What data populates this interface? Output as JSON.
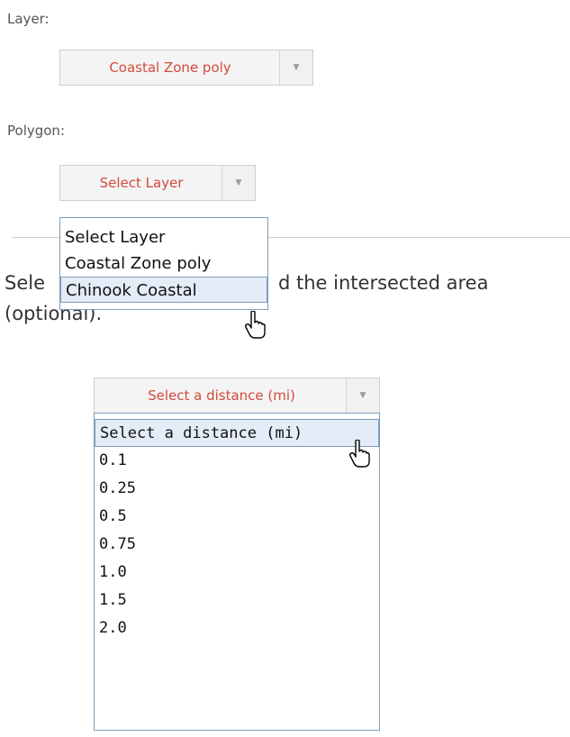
{
  "layer_field": {
    "label": "Layer:",
    "selected": "Coastal Zone poly"
  },
  "polygon_field": {
    "label": "Polygon:",
    "selected": "Select Layer",
    "options": [
      "Select Layer",
      "Coastal Zone poly",
      "Chinook Coastal"
    ],
    "hovered_option": "Chinook Coastal"
  },
  "distance_prompt": {
    "text_visible_left": "Sele",
    "text_visible_right": "d the intersected area",
    "text_line2": "(optional)."
  },
  "distance_field": {
    "selected": "Select a distance (mi)",
    "options": [
      "Select a distance (mi)",
      "0.1",
      "0.25",
      "0.5",
      "0.75",
      "1.0",
      "1.5",
      "2.0"
    ],
    "hovered_option": "Select a distance (mi)"
  },
  "icons": {
    "dropdown_arrow": "chevron-down-icon",
    "cursor": "hand-pointer-icon"
  },
  "colors": {
    "select_text": "#d24a3c",
    "dropdown_border": "#7f9db9",
    "hover_bg": "#e4ecf7"
  }
}
